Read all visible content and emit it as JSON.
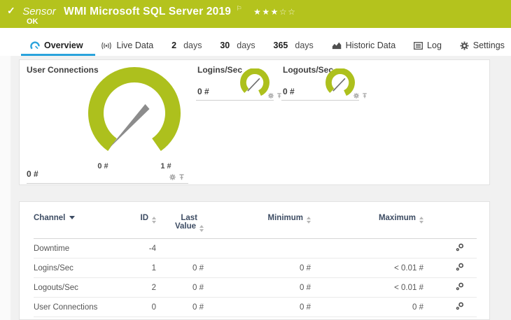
{
  "header": {
    "kind": "Sensor",
    "title": "WMI Microsoft SQL Server 2019",
    "status": "OK",
    "rating_filled": "★★★",
    "rating_empty": "☆☆"
  },
  "icons": {
    "check": "✓",
    "flag": "⚐"
  },
  "colors": {
    "header_green": "#b4c31d",
    "gauge_green": "#adc01d",
    "needle_gray": "#8c8c8c",
    "accent_blue": "#2aa3dc"
  },
  "tabs": [
    {
      "label": "Overview"
    },
    {
      "label": "Live Data"
    },
    {
      "num": "2",
      "unit": "days"
    },
    {
      "num": "30",
      "unit": "days"
    },
    {
      "num": "365",
      "unit": "days"
    },
    {
      "label": "Historic Data"
    },
    {
      "label": "Log"
    },
    {
      "label": "Settings"
    }
  ],
  "gauges": {
    "main": {
      "title": "User Connections",
      "value": "0 #",
      "scale_min": "0 #",
      "scale_max": "1 #"
    },
    "logins": {
      "title": "Logins/Sec",
      "value": "0 #"
    },
    "logouts": {
      "title": "Logouts/Sec",
      "value": "0 #"
    }
  },
  "table": {
    "headers": {
      "channel": "Channel",
      "id": "ID",
      "last1": "Last",
      "last2": "Value",
      "minimum": "Minimum",
      "maximum": "Maximum"
    },
    "rows": [
      {
        "channel": "Downtime",
        "id": "-4",
        "last": "",
        "min": "",
        "max": ""
      },
      {
        "channel": "Logins/Sec",
        "id": "1",
        "last": "0 #",
        "min": "0 #",
        "max": "< 0.01 #"
      },
      {
        "channel": "Logouts/Sec",
        "id": "2",
        "last": "0 #",
        "min": "0 #",
        "max": "< 0.01 #"
      },
      {
        "channel": "User Connections",
        "id": "0",
        "last": "0 #",
        "min": "0 #",
        "max": "0 #"
      }
    ]
  }
}
